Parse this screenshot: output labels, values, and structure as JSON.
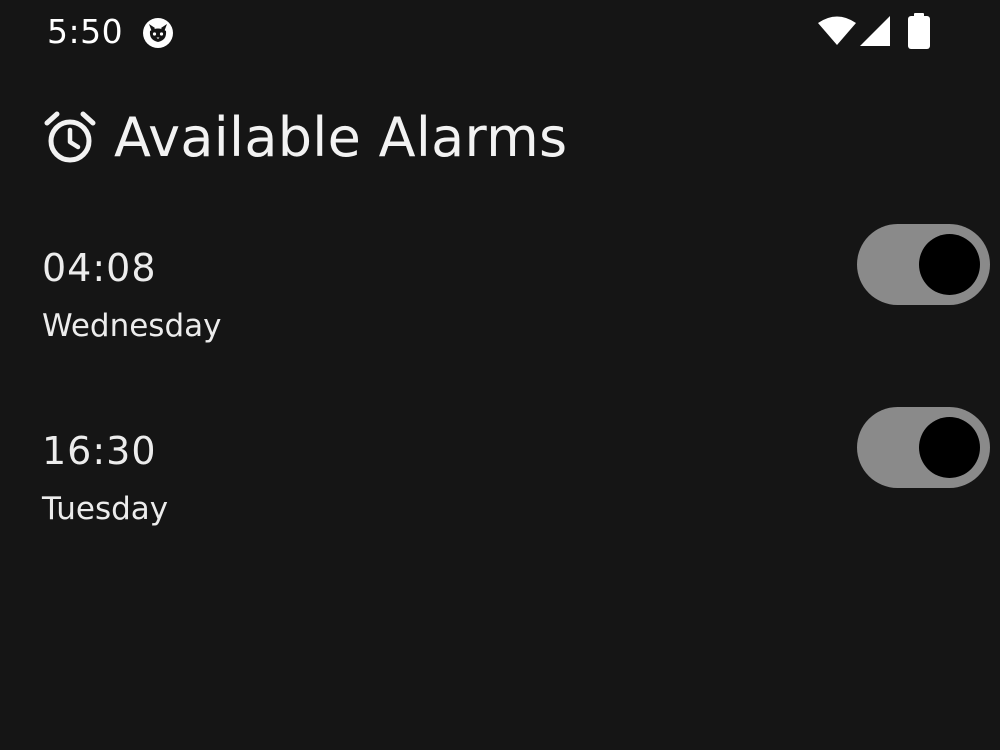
{
  "status_bar": {
    "time": "5:50",
    "app_icon": "cat-face-icon",
    "wifi_icon": "wifi-icon",
    "signal_icon": "cell-signal-icon",
    "battery_icon": "battery-icon"
  },
  "header": {
    "icon": "alarm-clock-icon",
    "title": "Available Alarms"
  },
  "alarms": [
    {
      "time": "04:08",
      "day": "Wednesday",
      "enabled": true
    },
    {
      "time": "16:30",
      "day": "Tuesday",
      "enabled": true
    }
  ],
  "colors": {
    "background": "#151515",
    "text": "#ececec",
    "toggle_track": "#8a8a8a",
    "toggle_knob": "#000000"
  }
}
